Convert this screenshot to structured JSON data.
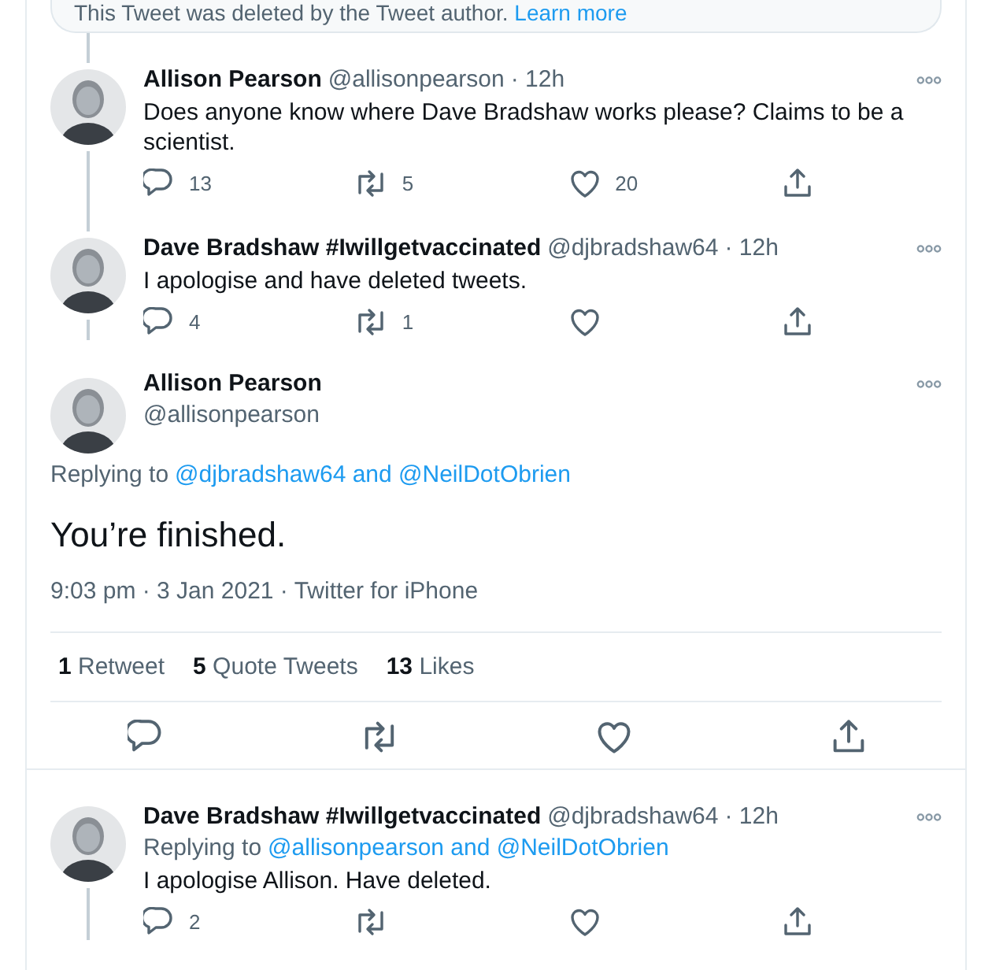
{
  "deleted_notice": {
    "text": "This Tweet was deleted by the Tweet author.",
    "link": "Learn more"
  },
  "tweets": [
    {
      "kind": "reply",
      "thread_above": true,
      "thread_below": true,
      "name": "Allison Pearson",
      "handle": "@allisonpearson",
      "time": "· 12h",
      "text": "Does anyone know where Dave Bradshaw works please? Claims to be a scientist.",
      "counts": {
        "reply": "13",
        "retweet": "5",
        "like": "20"
      }
    },
    {
      "kind": "reply",
      "thread_above": true,
      "thread_below": true,
      "name": "Dave Bradshaw #Iwillgetvaccinated",
      "handle": "@djbradshaw64",
      "time": "· 12h",
      "text": "I apologise and have deleted tweets.",
      "counts": {
        "reply": "4",
        "retweet": "1"
      }
    },
    {
      "kind": "main",
      "thread_above": false,
      "thread_below": false,
      "name": "Allison Pearson",
      "handle": "@allisonpearson",
      "replying_prefix": "Replying to",
      "replying_to": "@djbradshaw64 and @NeilDotObrien",
      "text": "You’re finished.",
      "meta": "9:03 pm · 3 Jan 2021 · Twitter for iPhone",
      "stats": [
        {
          "count": "1",
          "label": "Retweet"
        },
        {
          "count": "5",
          "label": "Quote Tweets"
        },
        {
          "count": "13",
          "label": "Likes"
        }
      ]
    },
    {
      "kind": "reply",
      "thread_above": false,
      "thread_below": true,
      "name": "Dave Bradshaw #Iwillgetvaccinated",
      "handle": "@djbradshaw64",
      "time": "· 12h",
      "replying_prefix": "Replying to",
      "replying_to": "@allisonpearson and @NeilDotObrien",
      "text": "I apologise Allison. Have deleted.",
      "counts": {
        "reply": "2"
      }
    }
  ]
}
